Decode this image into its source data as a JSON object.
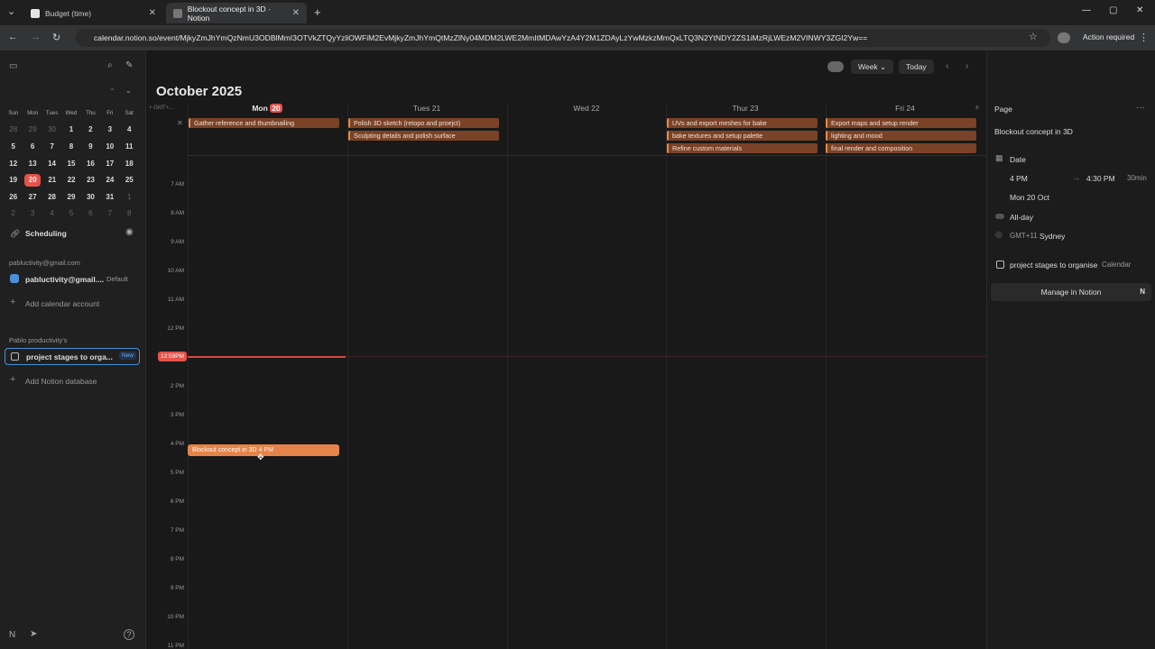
{
  "browser": {
    "tabs": [
      {
        "label": "Budget (time)",
        "active": false
      },
      {
        "label": "Blockout concept in 3D · Notion",
        "active": true
      }
    ],
    "url": "calendar.notion.so/event/MjkyZmJhYmQzNmU3ODBlMmI3OTVkZTQyYzliOWFiM2EvMjkyZmJhYmQtMzZlNy04MDM2LWE2MmItMDAwYzA4Y2M1ZDAyLzYwMzkzMmQxLTQ3N2YtNDY2ZS1iMzRjLWEzM2VINWY3ZGI2Yw==",
    "action_required": "Action required"
  },
  "sidebar": {
    "weekdays": [
      "Sun",
      "Mon",
      "Tues",
      "Wed",
      "Thu",
      "Fri",
      "Sat"
    ],
    "weeks": [
      [
        "28",
        "29",
        "30",
        "1",
        "2",
        "3",
        "4"
      ],
      [
        "5",
        "6",
        "7",
        "8",
        "9",
        "10",
        "11"
      ],
      [
        "12",
        "13",
        "14",
        "15",
        "16",
        "17",
        "18"
      ],
      [
        "19",
        "20",
        "21",
        "22",
        "23",
        "24",
        "25"
      ],
      [
        "26",
        "27",
        "28",
        "29",
        "30",
        "31",
        "1"
      ],
      [
        "2",
        "3",
        "4",
        "5",
        "6",
        "7",
        "8"
      ]
    ],
    "scheduling": "Scheduling",
    "account_header": "pabluctivity@gmail.com",
    "account_name": "pabluctivity@gmail....",
    "account_default": "Default",
    "add_calendar": "Add calendar account",
    "workspace": "Pablo productivity's",
    "database": "project stages to orga...",
    "database_badge": "New",
    "add_database": "Add Notion database"
  },
  "main": {
    "title": "October 2025",
    "view": "Week",
    "today": "Today",
    "timezone": "GMT+...",
    "days": [
      {
        "label": "Mon",
        "num": "20"
      },
      {
        "label": "Tues 21"
      },
      {
        "label": "Wed 22"
      },
      {
        "label": "Thur 23"
      },
      {
        "label": "Fri 24"
      }
    ],
    "hours": [
      "7 AM",
      "8 AM",
      "9 AM",
      "10 AM",
      "11 AM",
      "12 PM",
      "2 PM",
      "3 PM",
      "4 PM",
      "5 PM",
      "6 PM",
      "7 PM",
      "8 PM",
      "9 PM",
      "10 PM",
      "11 PM"
    ],
    "now": "12:59PM",
    "allday_events": {
      "mon": [
        "Gather reference and thumbnailing"
      ],
      "tue": [
        "Polish 3D sketch (retopo and proejct)",
        "Sculpting details and polish surface"
      ],
      "thu": [
        "UVs and export meshes for bake",
        "bake textures and setup palette",
        "Refine custom materials"
      ],
      "fri": [
        "Export maps and setup render",
        "lighting and mood",
        "final render and composition"
      ]
    },
    "event": {
      "title": "Blockout concept in 3D",
      "time": "4 PM"
    }
  },
  "panel": {
    "header": "Page",
    "title": "Blockout concept in 3D",
    "date_label": "Date",
    "start": "4 PM",
    "end": "4:30 PM",
    "duration": "30min",
    "date": "Mon 20 Oct",
    "allday": "All-day",
    "tz": "GMT+11",
    "tz_city": "Sydney",
    "db": "project stages to organise",
    "db_type": "Calendar",
    "manage": "Manage in Notion"
  }
}
